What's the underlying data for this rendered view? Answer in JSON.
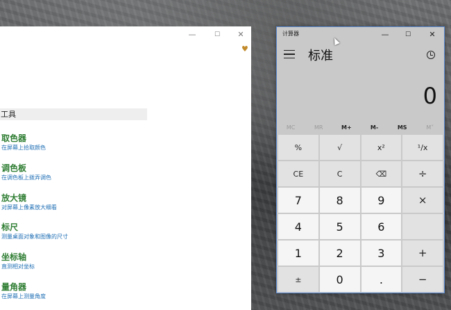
{
  "tools_window": {
    "titlebar": {
      "minimize": "—",
      "maximize": "☐",
      "close": "✕"
    },
    "header": "工具",
    "items": [
      {
        "title": "取色器",
        "desc": "在屏幕上拾取颜色"
      },
      {
        "title": "调色板",
        "desc": "在调色板上拨弄调色"
      },
      {
        "title": "放大镜",
        "desc": "对屏幕上像素放大细看"
      },
      {
        "title": "标尺",
        "desc": "测量桌面对象和图像的尺寸"
      },
      {
        "title": "坐标轴",
        "desc": "直测相对坐标"
      },
      {
        "title": "量角器",
        "desc": "在屏幕上测量角度"
      }
    ]
  },
  "calculator": {
    "app_title": "计算器",
    "titlebar": {
      "minimize": "—",
      "maximize": "☐",
      "close": "✕"
    },
    "mode": "标准",
    "display": "0",
    "memory": [
      {
        "label": "MC",
        "enabled": false
      },
      {
        "label": "MR",
        "enabled": false
      },
      {
        "label": "M+",
        "enabled": true
      },
      {
        "label": "M-",
        "enabled": true
      },
      {
        "label": "MS",
        "enabled": true
      },
      {
        "label": "M˅",
        "enabled": false
      }
    ],
    "keys": [
      {
        "label": "%",
        "kind": "fn"
      },
      {
        "label": "√",
        "kind": "fn"
      },
      {
        "label": "x²",
        "kind": "fn"
      },
      {
        "label": "¹/x",
        "kind": "fn"
      },
      {
        "label": "CE",
        "kind": "fn"
      },
      {
        "label": "C",
        "kind": "fn"
      },
      {
        "label": "⌫",
        "kind": "fn"
      },
      {
        "label": "÷",
        "kind": "op"
      },
      {
        "label": "7",
        "kind": "num"
      },
      {
        "label": "8",
        "kind": "num"
      },
      {
        "label": "9",
        "kind": "num"
      },
      {
        "label": "×",
        "kind": "op"
      },
      {
        "label": "4",
        "kind": "num"
      },
      {
        "label": "5",
        "kind": "num"
      },
      {
        "label": "6",
        "kind": "num"
      },
      {
        "label": "",
        "kind": "op"
      },
      {
        "label": "1",
        "kind": "num"
      },
      {
        "label": "2",
        "kind": "num"
      },
      {
        "label": "3",
        "kind": "num"
      },
      {
        "label": "+",
        "kind": "op"
      },
      {
        "label": "±",
        "kind": "fn"
      },
      {
        "label": "0",
        "kind": "num"
      },
      {
        "label": ".",
        "kind": "num"
      },
      {
        "label": "−",
        "kind": "op"
      }
    ]
  }
}
